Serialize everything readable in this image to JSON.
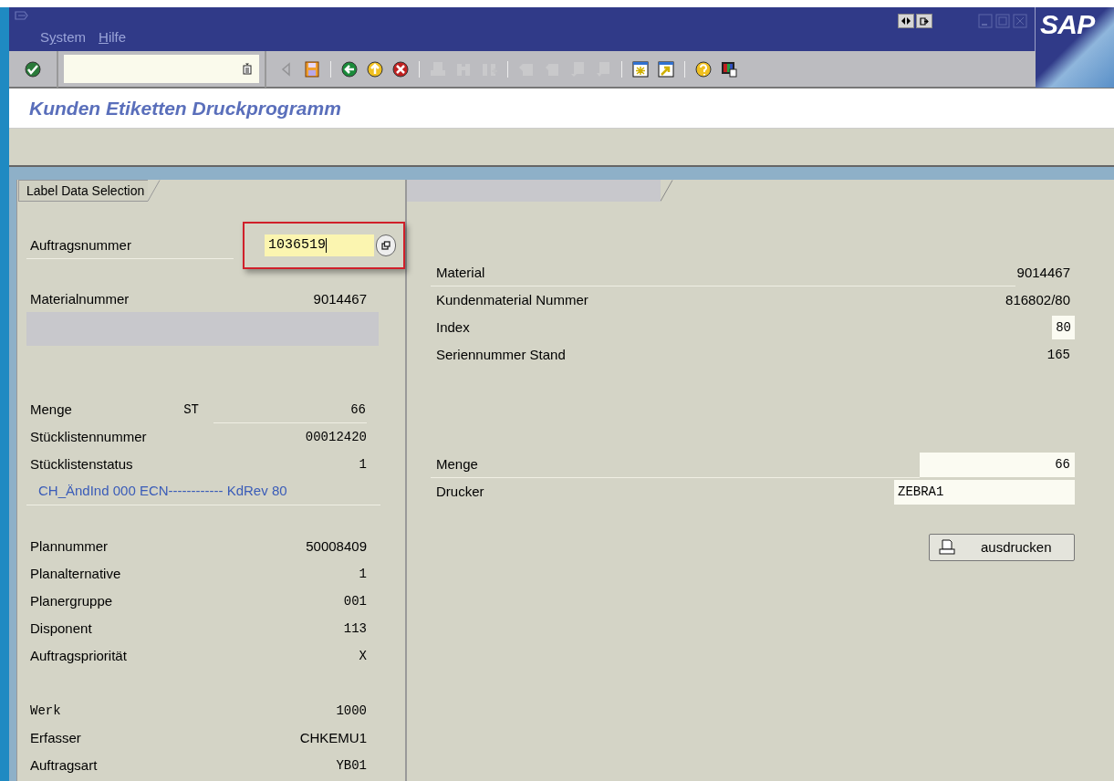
{
  "window": {
    "logo": "SAP"
  },
  "menu": [
    {
      "before": "S",
      "key": "y",
      "after": "stem"
    },
    {
      "key": "H",
      "after": "ilfe"
    }
  ],
  "toolbar": [
    {
      "kind": "enter",
      "disabled": false
    },
    {
      "kind": "command_field"
    },
    {
      "kind": "triangle",
      "disabled": true
    },
    {
      "kind": "save",
      "disabled": false
    },
    {
      "kind": "separator"
    },
    {
      "kind": "back",
      "disabled": false
    },
    {
      "kind": "exit",
      "disabled": false
    },
    {
      "kind": "cancel",
      "disabled": false
    },
    {
      "kind": "separator"
    },
    {
      "kind": "print",
      "disabled": true
    },
    {
      "kind": "find",
      "disabled": true
    },
    {
      "kind": "find_next",
      "disabled": true
    },
    {
      "kind": "separator"
    },
    {
      "kind": "first_page",
      "disabled": true
    },
    {
      "kind": "prev_page",
      "disabled": true
    },
    {
      "kind": "next_page",
      "disabled": true
    },
    {
      "kind": "last_page",
      "disabled": true
    },
    {
      "kind": "separator"
    },
    {
      "kind": "new_session",
      "disabled": false
    },
    {
      "kind": "shortcut",
      "disabled": false
    },
    {
      "kind": "separator"
    },
    {
      "kind": "help",
      "disabled": false
    },
    {
      "kind": "layout",
      "disabled": false
    }
  ],
  "title": "Kunden Etiketten Druckprogramm",
  "left_panel": {
    "tab": "Label Data Selection",
    "groups": [
      [
        {
          "kind": "input",
          "label": "Auftragsnummer",
          "value": "1036519",
          "highlighted": true,
          "underline": true
        }
      ],
      [
        {
          "kind": "display",
          "label": "Materialnummer",
          "value": "9014467",
          "mono": false
        },
        {
          "kind": "empty"
        }
      ],
      [
        {
          "kind": "display",
          "label": "Menge",
          "unit": "ST",
          "value": "66",
          "mono": true,
          "value_underline": true
        },
        {
          "kind": "display",
          "label": "Stücklistennummer",
          "value": "00012420",
          "mono": true
        },
        {
          "kind": "display",
          "label": "Stücklistenstatus",
          "value": "1",
          "mono": true
        },
        {
          "kind": "note",
          "label": "CH_ÄndInd 000 ECN------------ KdRev 80",
          "underline": true
        }
      ],
      [
        {
          "kind": "display",
          "label": "Plannummer",
          "value": "50008409",
          "mono": false
        },
        {
          "kind": "display",
          "label": "Planalternative",
          "value": "1",
          "mono": true
        },
        {
          "kind": "display",
          "label": "Planergruppe",
          "value": "001",
          "mono": true
        },
        {
          "kind": "display",
          "label": "Disponent",
          "value": "113",
          "mono": true
        },
        {
          "kind": "display",
          "label": "Auftragspriorität",
          "value": "X",
          "mono": true
        }
      ],
      [
        {
          "kind": "display",
          "label": "Werk",
          "label_mono": true,
          "value": "1000",
          "mono": true
        },
        {
          "kind": "display",
          "label": "Erfasser",
          "value": "CHKEMU1",
          "mono": false
        },
        {
          "kind": "display",
          "label": "Auftragsart",
          "value": "YB01",
          "mono": true
        }
      ]
    ]
  },
  "right_panel": {
    "groups": [
      [
        {
          "kind": "display",
          "label": "Material",
          "value": "9014467",
          "mono": false,
          "underline": true
        },
        {
          "kind": "display",
          "label": "Kundenmaterial Nummer",
          "value": "816802/80",
          "mono": false
        },
        {
          "kind": "boxed",
          "label": "Index",
          "value": "80",
          "mono": true
        },
        {
          "kind": "display",
          "label": "Seriennummer Stand",
          "value": "165",
          "mono": true
        }
      ],
      [
        {
          "kind": "number_input",
          "label": "Menge",
          "value": "66",
          "underline": true
        },
        {
          "kind": "text_input",
          "label": "Drucker",
          "value": "ZEBRA1"
        }
      ]
    ],
    "print_button": "ausdrucken"
  }
}
